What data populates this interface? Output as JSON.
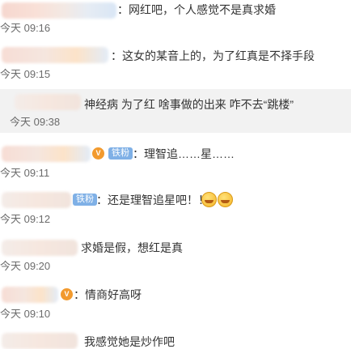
{
  "comments": [
    {
      "text": "：网红吧，个人感觉不是真求婚",
      "time": "今天 09:16"
    },
    {
      "text": "：这女的某音上的，为了红真是不择手段",
      "time": "今天 09:15"
    },
    {
      "text": "神经病 为了红 啥事做的出来 咋不去“跳楼”",
      "time": "今天 09:38"
    },
    {
      "text": "：理智追……星……",
      "time": "今天 09:11",
      "badge": "铁粉"
    },
    {
      "text": "：还是理智追星吧！！",
      "time": "今天 09:12",
      "badge": "铁粉"
    },
    {
      "text": "求婚是假，想红是真",
      "time": "今天 09:20"
    },
    {
      "text": "：情商好高呀",
      "time": "今天 09:10"
    },
    {
      "text": "我感觉她是炒作吧",
      "time": ""
    }
  ],
  "icons": {
    "vip": "vip-crown-icon",
    "emoji": "laughing-tears-emoji"
  }
}
